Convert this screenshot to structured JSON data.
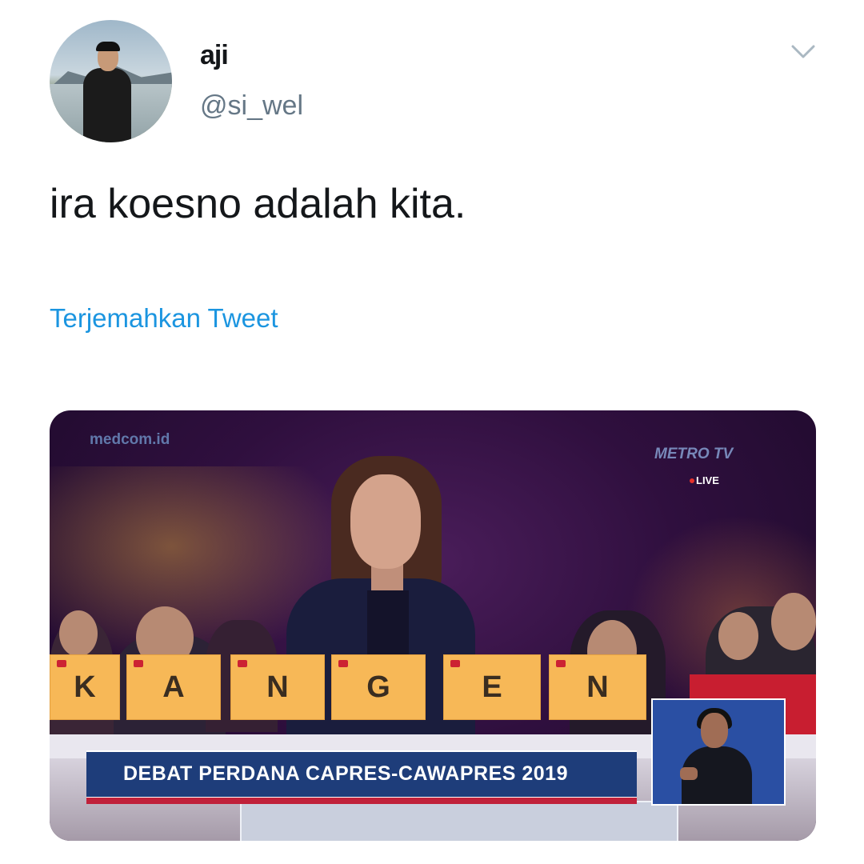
{
  "tweet": {
    "author_name": "aji",
    "handle": "@si_wel",
    "text": "ira koesno adalah kita.",
    "translate_label": "Terjemahkan Tweet",
    "avatar_icon": "profile-avatar",
    "menu_icon": "chevron-down-icon",
    "translate_color": "#1b95e0"
  },
  "media": {
    "watermark_left": "medcom.id",
    "watermark_right": "METRO TV",
    "live_label": "LIVE",
    "letter_cards": [
      "K",
      "A",
      "N",
      "G",
      "E",
      "N"
    ],
    "banner_text": "DEBAT PERDANA CAPRES-CAWAPRES 2019",
    "banner_color": "#1e3d7a"
  }
}
